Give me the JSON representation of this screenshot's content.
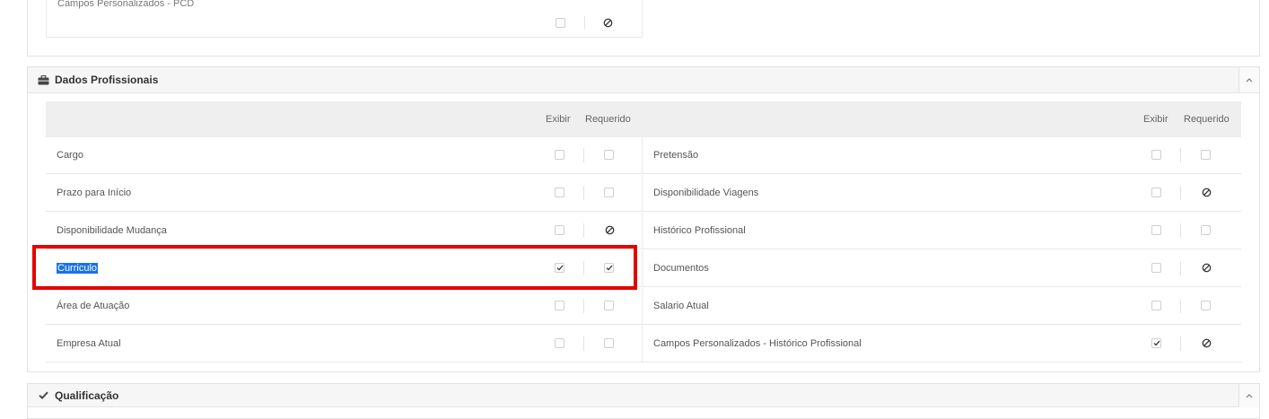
{
  "previous_section": {
    "row_label": "Campos Personalizados - PCD"
  },
  "dados_profissionais": {
    "title": "Dados Profissionais",
    "header_icon": "briefcase-icon",
    "collapse_icon": "chevron-up-icon",
    "columns": {
      "left": {
        "exibir": "Exibir",
        "requerido": "Requerido"
      },
      "right": {
        "exibir": "Exibir",
        "requerido": "Requerido"
      }
    },
    "rows": [
      {
        "left": {
          "label": "Cargo",
          "exibir": "unchecked",
          "requerido": "unchecked"
        },
        "right": {
          "label": "Pretensão",
          "exibir": "unchecked",
          "requerido": "unchecked"
        }
      },
      {
        "left": {
          "label": "Prazo para Início",
          "exibir": "unchecked",
          "requerido": "unchecked"
        },
        "right": {
          "label": "Disponibilidade Viagens",
          "exibir": "unchecked",
          "requerido": "disabled"
        }
      },
      {
        "left": {
          "label": "Disponibilidade Mudança",
          "exibir": "unchecked",
          "requerido": "disabled"
        },
        "right": {
          "label": "Histórico Profissional",
          "exibir": "unchecked",
          "requerido": "unchecked"
        }
      },
      {
        "left": {
          "label": "Curriculo",
          "exibir": "checked",
          "requerido": "checked",
          "text_selected": true
        },
        "right": {
          "label": "Documentos",
          "exibir": "unchecked",
          "requerido": "disabled"
        }
      },
      {
        "left": {
          "label": "Área de Atuação",
          "exibir": "unchecked",
          "requerido": "unchecked"
        },
        "right": {
          "label": "Salario Atual",
          "exibir": "unchecked",
          "requerido": "unchecked"
        }
      },
      {
        "left": {
          "label": "Empresa Atual",
          "exibir": "unchecked",
          "requerido": "unchecked"
        },
        "right": {
          "label": "Campos Personalizados - Histórico Profissional",
          "exibir": "checked",
          "requerido": "disabled"
        }
      }
    ]
  },
  "qualificacao": {
    "title": "Qualificação",
    "header_icon": "check-icon",
    "collapse_icon": "chevron-up-icon"
  },
  "colors": {
    "highlight_box": "#e60000",
    "text_selection": "#1a73e8"
  }
}
